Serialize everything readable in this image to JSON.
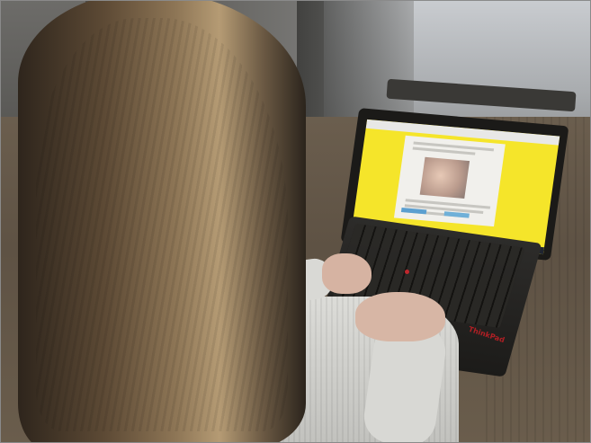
{
  "scene": {
    "caption": "",
    "laptop_brand_text": "ThinkPad"
  },
  "colors": {
    "screen_background": "#f5e52a",
    "sweater": "#dcdcd8",
    "hair": "#8e7656",
    "table": "#6b5e4e"
  },
  "icons": [
    "photo-thumbnail",
    "taskbar"
  ]
}
